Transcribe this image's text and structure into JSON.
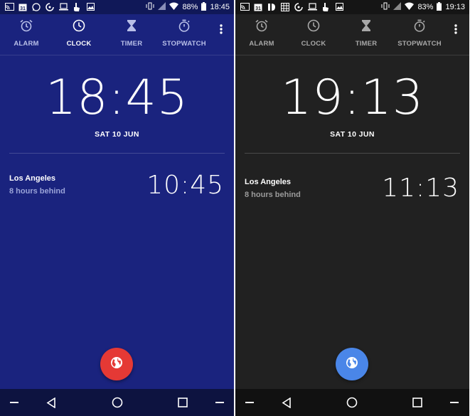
{
  "panels": [
    {
      "id": "light",
      "status": {
        "battery_text": "88%",
        "time": "18:45"
      },
      "tabs": [
        {
          "label": "ALARM",
          "icon": "alarm-icon",
          "active": false
        },
        {
          "label": "CLOCK",
          "icon": "clock-icon",
          "active": true
        },
        {
          "label": "TIMER",
          "icon": "hourglass-icon",
          "active": false
        },
        {
          "label": "STOPWATCH",
          "icon": "stopwatch-icon",
          "active": false
        }
      ],
      "main_time": "18:45",
      "main_date": "SAT 10 JUN",
      "city": {
        "name": "Los Angeles",
        "offset": "8 hours behind",
        "time": "10:45"
      },
      "fab_icon": "globe-icon",
      "colors": {
        "background": "#1a237e",
        "fab": "#e53935"
      }
    },
    {
      "id": "dark",
      "status": {
        "battery_text": "83%",
        "time": "19:13"
      },
      "tabs": [
        {
          "label": "ALARM",
          "icon": "alarm-icon",
          "active": false
        },
        {
          "label": "CLOCK",
          "icon": "clock-icon",
          "active": true
        },
        {
          "label": "TIMER",
          "icon": "hourglass-icon",
          "active": false
        },
        {
          "label": "STOPWATCH",
          "icon": "stopwatch-icon",
          "active": false
        }
      ],
      "main_time": "19:13",
      "main_date": "SAT 10 JUN",
      "city": {
        "name": "Los Angeles",
        "offset": "8 hours behind",
        "time": "11:13"
      },
      "fab_icon": "globe-icon",
      "colors": {
        "background": "#212121",
        "fab": "#4a86e8"
      }
    }
  ]
}
